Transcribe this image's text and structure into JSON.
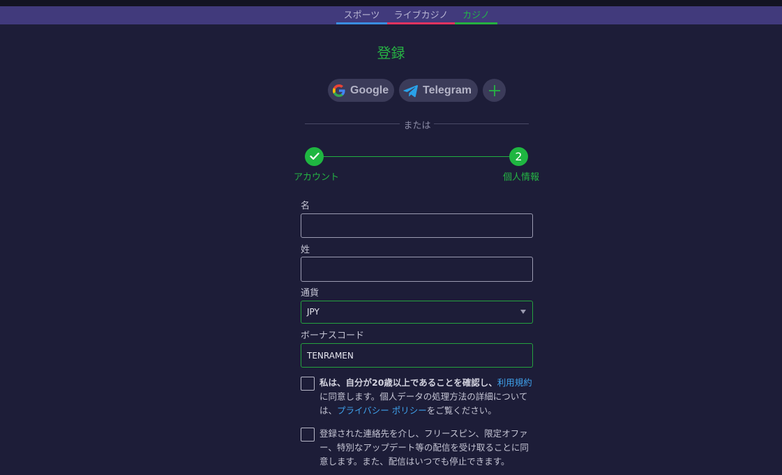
{
  "nav": {
    "tabs": [
      {
        "label": "スポーツ",
        "underline": "#3a8de0"
      },
      {
        "label": "ライブカジノ",
        "underline": "#e0335f"
      },
      {
        "label": "カジノ",
        "underline": "#25b040",
        "active": true
      }
    ]
  },
  "page": {
    "title": "登録"
  },
  "social": {
    "google_label": "Google",
    "telegram_label": "Telegram",
    "more_icon": "plus-icon"
  },
  "divider": {
    "or_text": "または"
  },
  "steps": [
    {
      "label": "アカウント",
      "state": "done",
      "icon": "check-icon"
    },
    {
      "label": "個人情報",
      "state": "current",
      "number": "2"
    }
  ],
  "form": {
    "first_name": {
      "label": "名",
      "value": "",
      "placeholder": ""
    },
    "last_name": {
      "label": "姓",
      "value": "",
      "placeholder": ""
    },
    "currency": {
      "label": "通貨",
      "value": "JPY"
    },
    "bonus_code": {
      "label": "ボーナスコード",
      "value": "TENRAMEN"
    }
  },
  "consent": {
    "age": {
      "bold": "私は、自分が20歳以上であることを確認し、",
      "terms_link": "利用規約",
      "text_mid": "に同意します。個人データの処理方法の詳細については、",
      "privacy_link": "プライバシー ポリシー",
      "text_end": "をご覧ください。"
    },
    "marketing": {
      "text": "登録された連絡先を介し、フリースピン、限定オファー、特別なアップデート等の配信を受け取ることに同意します。また、配信はいつでも停止できます。"
    }
  },
  "colors": {
    "accent_green": "#1fb641",
    "link_blue": "#3fa3ee",
    "background": "#1d1d38",
    "tabbar": "#413a7c"
  }
}
